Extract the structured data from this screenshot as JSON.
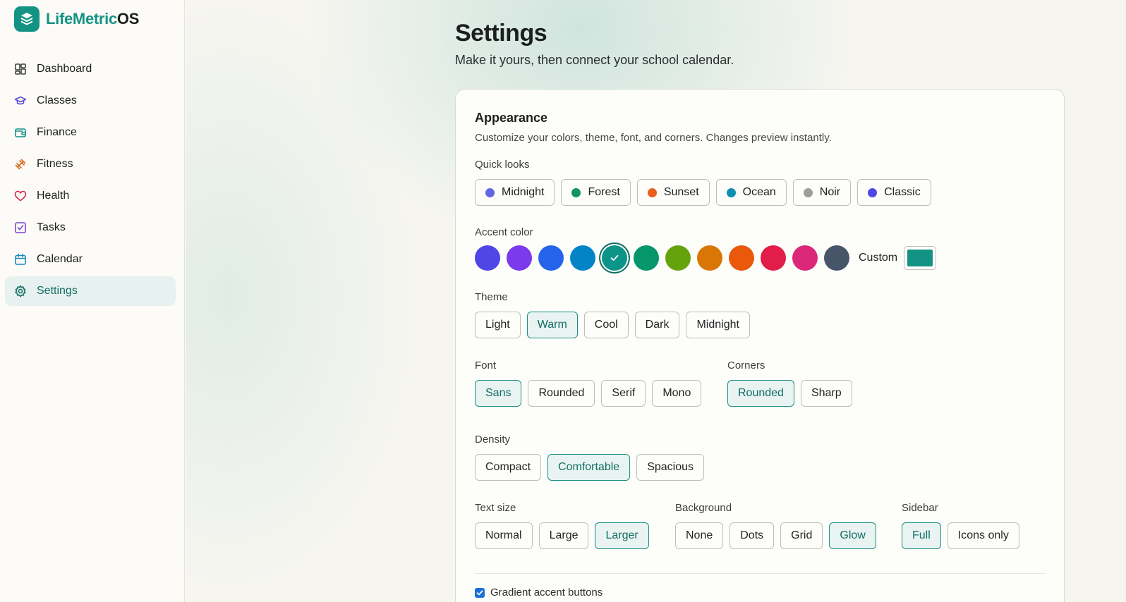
{
  "brand": {
    "name_part1": "LifeMetric",
    "name_part2": "OS"
  },
  "nav": [
    {
      "label": "Dashboard",
      "icon": "dashboard-icon",
      "color": "#3c4240"
    },
    {
      "label": "Classes",
      "icon": "graduation-cap-icon",
      "color": "#5b4fd6"
    },
    {
      "label": "Finance",
      "icon": "wallet-icon",
      "color": "#149385"
    },
    {
      "label": "Fitness",
      "icon": "dumbbell-icon",
      "color": "#d9661b"
    },
    {
      "label": "Health",
      "icon": "heart-icon",
      "color": "#d62a4d"
    },
    {
      "label": "Tasks",
      "icon": "checkbox-icon",
      "color": "#7c45d8"
    },
    {
      "label": "Calendar",
      "icon": "calendar-icon",
      "color": "#1d86c6"
    },
    {
      "label": "Settings",
      "icon": "gear-icon",
      "color": "#116e64",
      "active": true
    }
  ],
  "page": {
    "title": "Settings",
    "subtitle": "Make it yours, then connect your school calendar."
  },
  "appearance": {
    "title": "Appearance",
    "description": "Customize your colors, theme, font, and corners. Changes preview instantly.",
    "quick_looks": {
      "label": "Quick looks",
      "options": [
        {
          "label": "Midnight",
          "color": "#6366e1"
        },
        {
          "label": "Forest",
          "color": "#109464"
        },
        {
          "label": "Sunset",
          "color": "#e8601c"
        },
        {
          "label": "Ocean",
          "color": "#0e8fb0"
        },
        {
          "label": "Noir",
          "color": "#9b9e9f"
        },
        {
          "label": "Classic",
          "color": "#4f46e5"
        }
      ]
    },
    "accent": {
      "label": "Accent color",
      "swatches": [
        "#4f46e5",
        "#7c3aed",
        "#2563eb",
        "#0284c7",
        "#0d9488",
        "#059669",
        "#65a30d",
        "#d97706",
        "#ea580c",
        "#e11d48",
        "#db2777",
        "#475569"
      ],
      "selected_index": 4,
      "custom_label": "Custom",
      "custom_color": "#149385"
    },
    "theme": {
      "label": "Theme",
      "options": [
        "Light",
        "Warm",
        "Cool",
        "Dark",
        "Midnight"
      ],
      "selected": "Warm"
    },
    "font": {
      "label": "Font",
      "options": [
        "Sans",
        "Rounded",
        "Serif",
        "Mono"
      ],
      "selected": "Sans"
    },
    "corners": {
      "label": "Corners",
      "options": [
        "Rounded",
        "Sharp"
      ],
      "selected": "Rounded"
    },
    "density": {
      "label": "Density",
      "options": [
        "Compact",
        "Comfortable",
        "Spacious"
      ],
      "selected": "Comfortable"
    },
    "text_size": {
      "label": "Text size",
      "options": [
        "Normal",
        "Large",
        "Larger"
      ],
      "selected": "Larger"
    },
    "background": {
      "label": "Background",
      "options": [
        "None",
        "Dots",
        "Grid",
        "Glow"
      ],
      "selected": "Glow"
    },
    "sidebar": {
      "label": "Sidebar",
      "options": [
        "Full",
        "Icons only"
      ],
      "selected": "Full"
    },
    "gradient_buttons": {
      "label": "Gradient accent buttons",
      "checked": true
    }
  }
}
